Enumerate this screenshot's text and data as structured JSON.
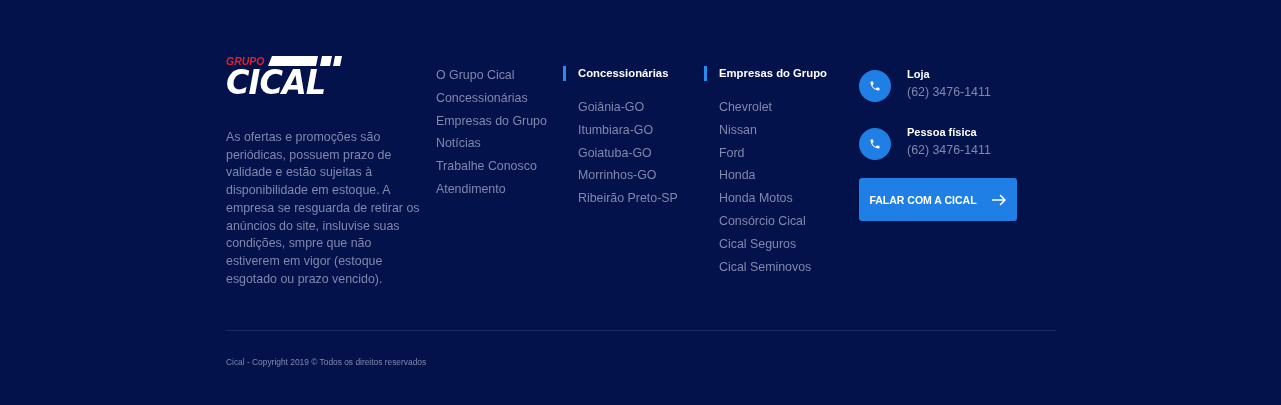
{
  "logo": {
    "top": "GRUPO",
    "main": "CICAL"
  },
  "disclaimer": "As ofertas e promoções são periódicas, possuem prazo de validade e estão sujeitas à disponibilidade em estoque. A empresa se resguarda de retirar os anúncios do site, insluvise suas condições, smpre que não estiverem em vigor (estoque esgotado ou prazo vencido).",
  "nav": [
    "O Grupo Cical",
    "Concessionárias",
    "Empresas do Grupo",
    "Notícias",
    "Trabalhe Conosco",
    "Atendimento"
  ],
  "columns": [
    {
      "title": "Concessionárias",
      "items": [
        "Goiânia-GO",
        "Itumbiara-GO",
        "Goiatuba-GO",
        "Morrinhos-GO",
        "Ribeirão Preto-SP"
      ]
    },
    {
      "title": "Empresas do Grupo",
      "items": [
        "Chevrolet",
        "Nissan",
        "Ford",
        "Honda",
        "Honda Motos",
        "Consórcio Cical",
        "Cical Seguros",
        "Cical Seminovos"
      ]
    }
  ],
  "contacts": [
    {
      "label": "Loja",
      "phone": "(62) 3476-1411"
    },
    {
      "label": "Pessoa física",
      "phone": "(62) 3476-1411"
    }
  ],
  "cta": {
    "label": "FALAR COM A CICAL"
  },
  "copyright": "Cical - Copyright 2019 © Todos os direitos reservados"
}
